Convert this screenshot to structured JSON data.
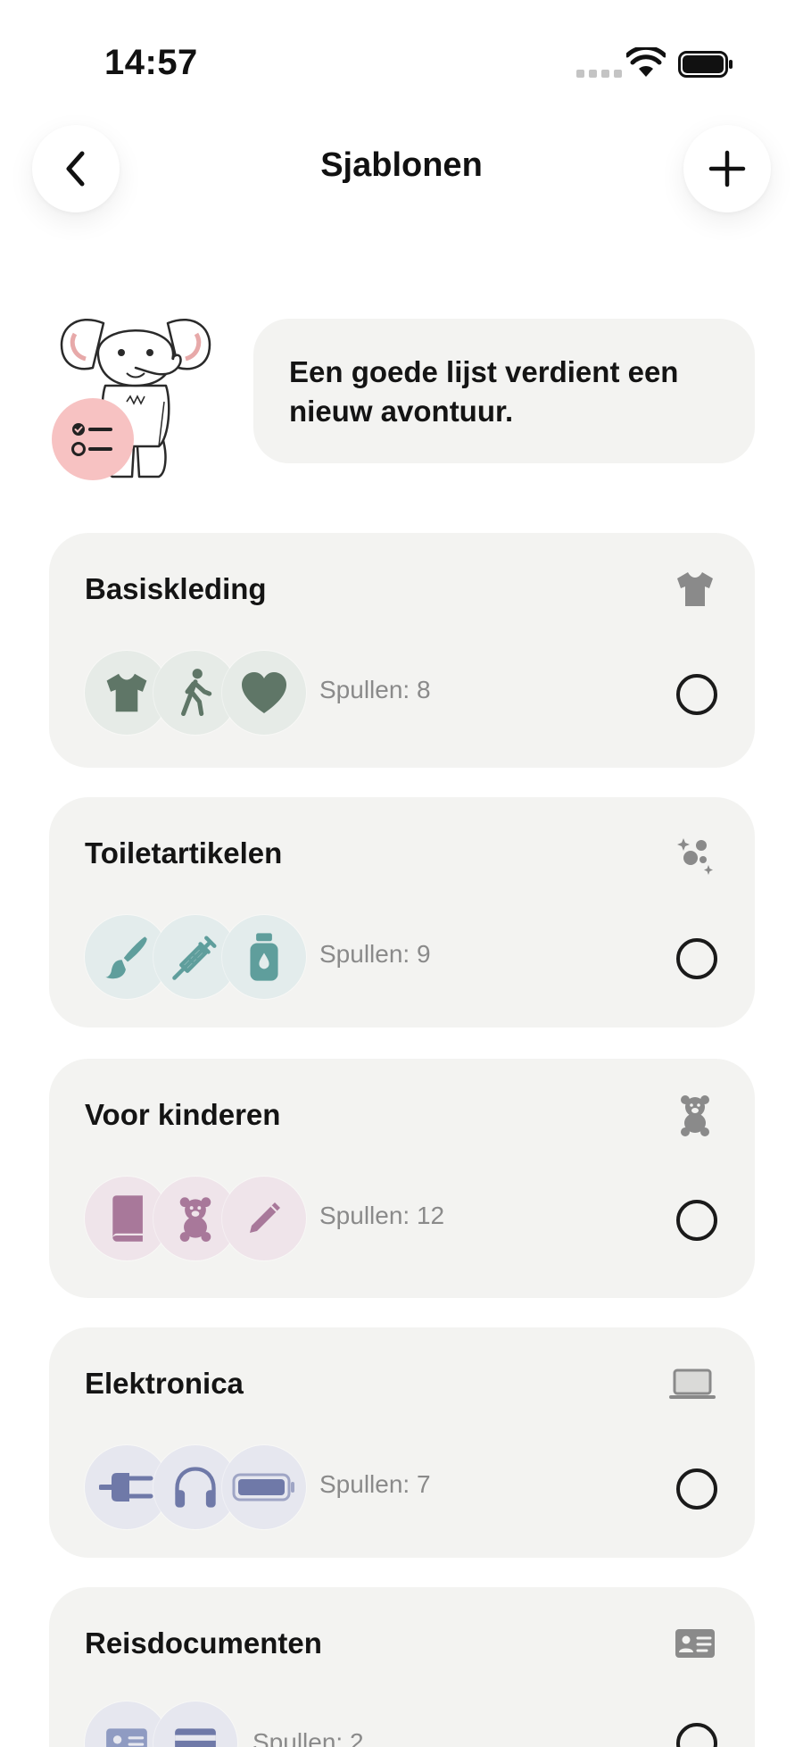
{
  "status_bar": {
    "time": "14:57"
  },
  "nav": {
    "title": "Sjablonen"
  },
  "header": {
    "message": "Een goede lijst verdient een nieuw avontuur."
  },
  "colors": {
    "card_bg": "#f3f3f1",
    "clothing_bubble": "#e6ebe7",
    "clothing_icon": "#5f7667",
    "toiletry_bubble": "#e3ecec",
    "toiletry_icon": "#5f9e9c",
    "kids_bubble": "#efe4ea",
    "kids_icon": "#a8789a",
    "electronics_bubble": "#e6e7ef",
    "electronics_icon": "#6f79a8",
    "badge": "#f7c2c2"
  },
  "templates": [
    {
      "title": "Basiskleding",
      "count_label": "Spullen: 8",
      "header_icon": "tshirt-icon",
      "item_icons": [
        "tshirt-icon",
        "walking-person-icon",
        "heart-icon"
      ]
    },
    {
      "title": "Toiletartikelen",
      "count_label": "Spullen: 9",
      "header_icon": "bubbles-sparkle-icon",
      "item_icons": [
        "paintbrush-icon",
        "syringe-icon",
        "lotion-bottle-icon"
      ]
    },
    {
      "title": "Voor kinderen",
      "count_label": "Spullen: 12",
      "header_icon": "teddy-bear-icon",
      "item_icons": [
        "book-icon",
        "teddy-bear-icon",
        "pencil-icon"
      ]
    },
    {
      "title": "Elektronica",
      "count_label": "Spullen: 7",
      "header_icon": "laptop-icon",
      "item_icons": [
        "plug-icon",
        "headphones-icon",
        "battery-icon"
      ]
    },
    {
      "title": "Reisdocumenten",
      "count_label": "Spullen: 2",
      "header_icon": "id-card-icon",
      "item_icons": [
        "id-card-icon",
        "credit-card-icon"
      ]
    }
  ]
}
